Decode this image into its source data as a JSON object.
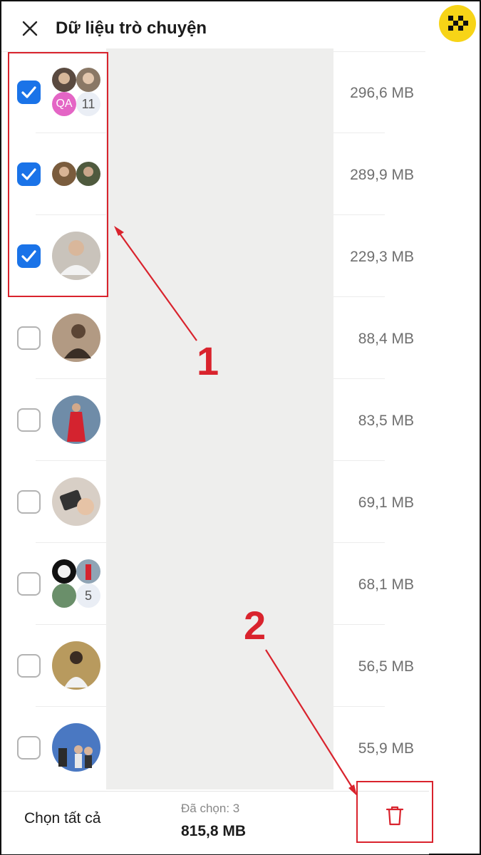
{
  "header": {
    "title": "Dữ liệu trò chuyện"
  },
  "rows": [
    {
      "checked": true,
      "size": "296,6 MB",
      "group": true,
      "initials": "QA",
      "count": "11"
    },
    {
      "checked": true,
      "size": "289,9 MB",
      "group": true
    },
    {
      "checked": true,
      "size": "229,3 MB"
    },
    {
      "checked": false,
      "size": "88,4 MB"
    },
    {
      "checked": false,
      "size": "83,5 MB"
    },
    {
      "checked": false,
      "size": "69,1 MB"
    },
    {
      "checked": false,
      "size": "68,1 MB",
      "group": true,
      "count": "5"
    },
    {
      "checked": false,
      "size": "56,5 MB"
    },
    {
      "checked": false,
      "size": "55,9 MB"
    }
  ],
  "footer": {
    "select_all": "Chọn tất cả",
    "selected_label": "Đã chọn: 3",
    "selected_total": "815,8 MB"
  },
  "annotations": {
    "step1": "1",
    "step2": "2"
  },
  "colors": {
    "accent": "#1a73e8",
    "annotation": "#d9232d"
  },
  "icons": {
    "close": "close-icon",
    "delete": "trash-icon",
    "check": "checkmark-icon"
  }
}
